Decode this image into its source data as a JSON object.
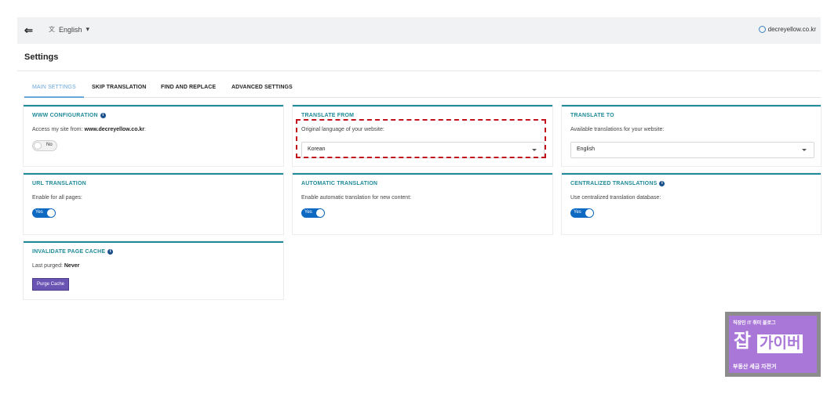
{
  "topbar": {
    "back_icon": "collapse-icon",
    "language": "English",
    "language_caret": "▾",
    "translate_icon": "translate-icon",
    "site": "decreyellow.co.kr"
  },
  "page_title": "Settings",
  "tabs": [
    {
      "label": "MAIN SETTINGS",
      "active": true
    },
    {
      "label": "SKIP TRANSLATION",
      "active": false
    },
    {
      "label": "FIND AND REPLACE",
      "active": false
    },
    {
      "label": "ADVANCED SETTINGS",
      "active": false
    }
  ],
  "cards": {
    "www": {
      "title": "WWW CONFIGURATION",
      "desc_prefix": "Access my site from: ",
      "desc_value": "www.decreyellow.co.kr",
      "desc_suffix": ":",
      "toggle": "No"
    },
    "translate_from": {
      "title": "TRANSLATE FROM",
      "desc": "Original language of your website:",
      "value": "Korean"
    },
    "translate_to": {
      "title": "TRANSLATE TO",
      "desc": "Available translations for your website:",
      "value": "English"
    },
    "url_translation": {
      "title": "URL TRANSLATION",
      "desc": "Enable for all pages:",
      "toggle": "Yes"
    },
    "automatic_translation": {
      "title": "AUTOMATIC TRANSLATION",
      "desc": "Enable automatic translation for new content:",
      "toggle": "Yes"
    },
    "centralized": {
      "title": "CENTRALIZED TRANSLATIONS",
      "desc": "Use centralized translation database:",
      "toggle": "Yes"
    },
    "cache": {
      "title": "INVALIDATE PAGE CACHE",
      "desc_prefix": "Last purged: ",
      "desc_value": "Never",
      "button": "Purge Cache"
    }
  },
  "watermark": {
    "line1": "직장인 IT 취미 블로그",
    "big1": "잡",
    "big2": "가이버",
    "line2": "부동산 세금 자전거"
  },
  "colors": {
    "accent": "#1f8a99",
    "toggle_on": "#0d69c2",
    "tab_active": "#6aa7d8",
    "button": "#6b55b4",
    "highlight": "#c0131b"
  }
}
